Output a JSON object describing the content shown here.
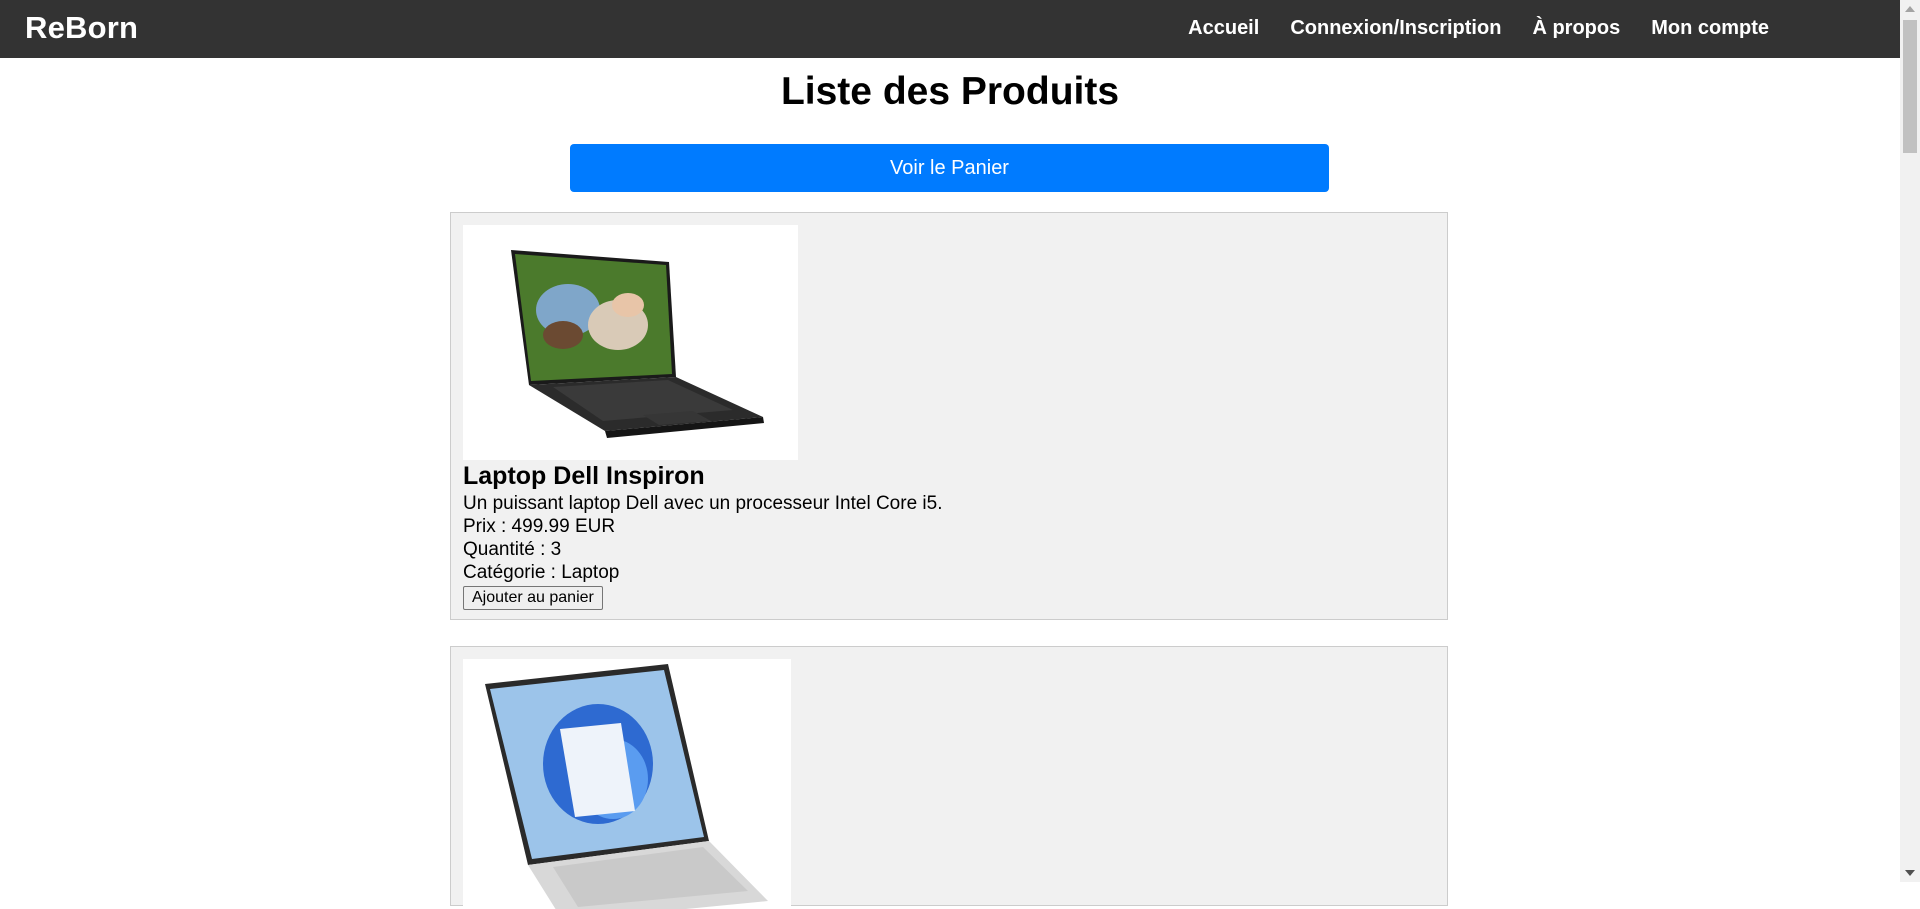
{
  "navbar": {
    "brand": "ReBorn",
    "links": [
      "Accueil",
      "Connexion/Inscription",
      "À propos",
      "Mon compte"
    ]
  },
  "main": {
    "title": "Liste des Produits",
    "cart_button": "Voir le Panier"
  },
  "products": [
    {
      "image_icon": "dell-laptop-photo",
      "name": "Laptop Dell Inspiron",
      "description": "Un puissant laptop Dell avec un processeur Intel Core i5.",
      "price": "Prix : 499.99 EUR",
      "quantity": "Quantité : 3",
      "category": "Catégorie : Laptop",
      "button": "Ajouter au panier"
    },
    {
      "image_icon": "hp-laptop-photo"
    }
  ],
  "colors": {
    "navbar_bg": "#333333",
    "accent": "#007bff",
    "card_bg": "#f1f1f1"
  }
}
